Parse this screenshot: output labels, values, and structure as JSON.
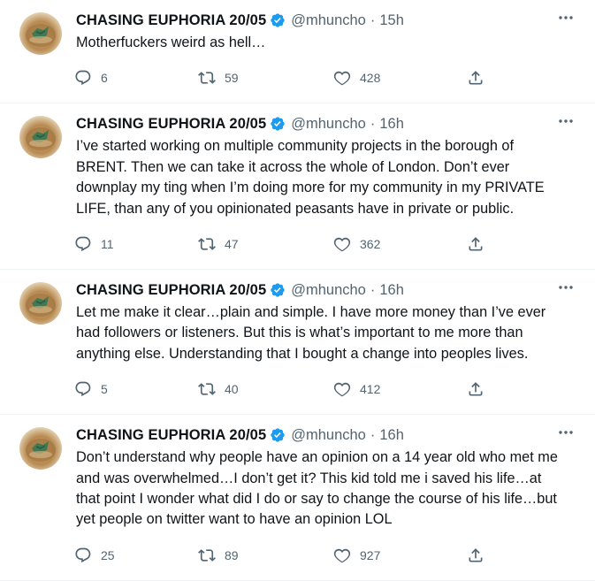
{
  "tweets": [
    {
      "name": "CHASING EUPHORIA 20/05",
      "handle": "@mhuncho",
      "separator": "·",
      "time": "15h",
      "text": "Motherfuckers weird as hell…",
      "replies": "6",
      "retweets": "59",
      "likes": "428"
    },
    {
      "name": "CHASING EUPHORIA 20/05",
      "handle": "@mhuncho",
      "separator": "·",
      "time": "16h",
      "text": "I’ve started working on multiple community projects in the borough of\nBRENT. Then we can take it across the whole of London. Don’t ever\ndownplay my ting when I’m doing more for my community in my PRIVATE\nLIFE, than any of you opinionated peasants have in private or public.",
      "replies": "11",
      "retweets": "47",
      "likes": "362"
    },
    {
      "name": "CHASING EUPHORIA 20/05",
      "handle": "@mhuncho",
      "separator": "·",
      "time": "16h",
      "text": "Let me make it clear…plain and simple. I have more money than I’ve ever\nhad followers or listeners. But this is what’s important to me more than\nanything else. Understanding that I bought a change into peoples lives.",
      "replies": "5",
      "retweets": "40",
      "likes": "412"
    },
    {
      "name": "CHASING EUPHORIA 20/05",
      "handle": "@mhuncho",
      "separator": "·",
      "time": "16h",
      "text": "Don’t understand why people have an opinion on a 14 year old who met me\nand was overwhelmed…I don’t get it? This kid told me i saved his life…at\nthat point I wonder what did I do or say to change the course of his life…but\nyet people on twitter want to have an opinion LOL",
      "replies": "25",
      "retweets": "89",
      "likes": "927"
    }
  ],
  "icons": {
    "verified": "verified-badge-icon",
    "more": "more-dots-icon",
    "reply": "reply-icon",
    "retweet": "retweet-icon",
    "like": "heart-icon",
    "share": "share-icon"
  },
  "colors": {
    "verified": "#1d9bf0",
    "secondary_text": "#536471",
    "divider": "#eff3f4"
  }
}
